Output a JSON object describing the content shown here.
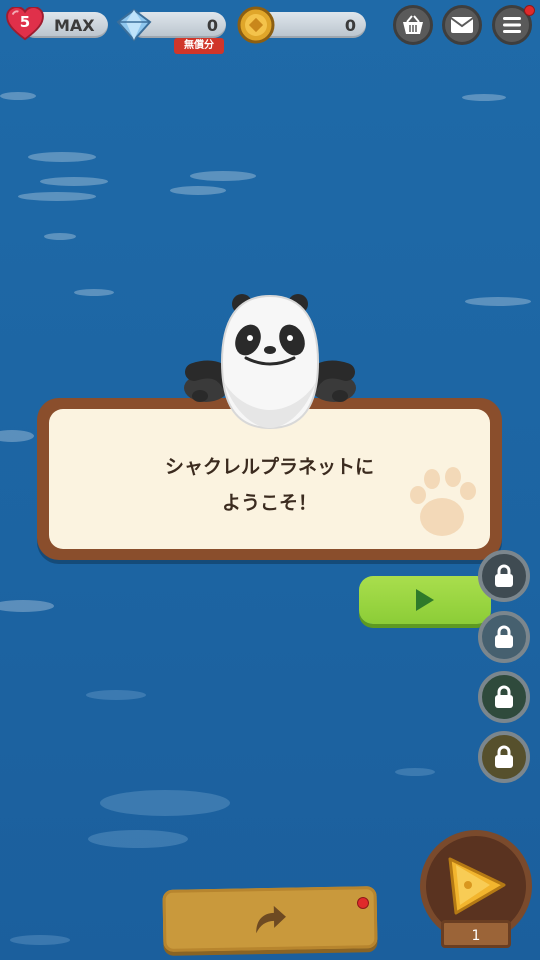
{
  "hud": {
    "lives": "5",
    "lives_status": "MAX",
    "gems": "0",
    "gems_badge": "無償分",
    "coins": "0",
    "icons": {
      "shop": "shop-basket-icon",
      "mail": "mail-icon",
      "menu": "hamburger-menu-icon"
    }
  },
  "dialog": {
    "line1": "シャクレルプラネットに",
    "line2": "ようこそ！"
  },
  "levels": {
    "plate_number": "1"
  },
  "colors": {
    "water": "#1d66a4",
    "dialog_border": "#8a4e2c",
    "dialog_bg": "#fbf3e0",
    "next_button": "#9bd542",
    "share_button": "#c9993c",
    "notification": "#e02a2a"
  }
}
